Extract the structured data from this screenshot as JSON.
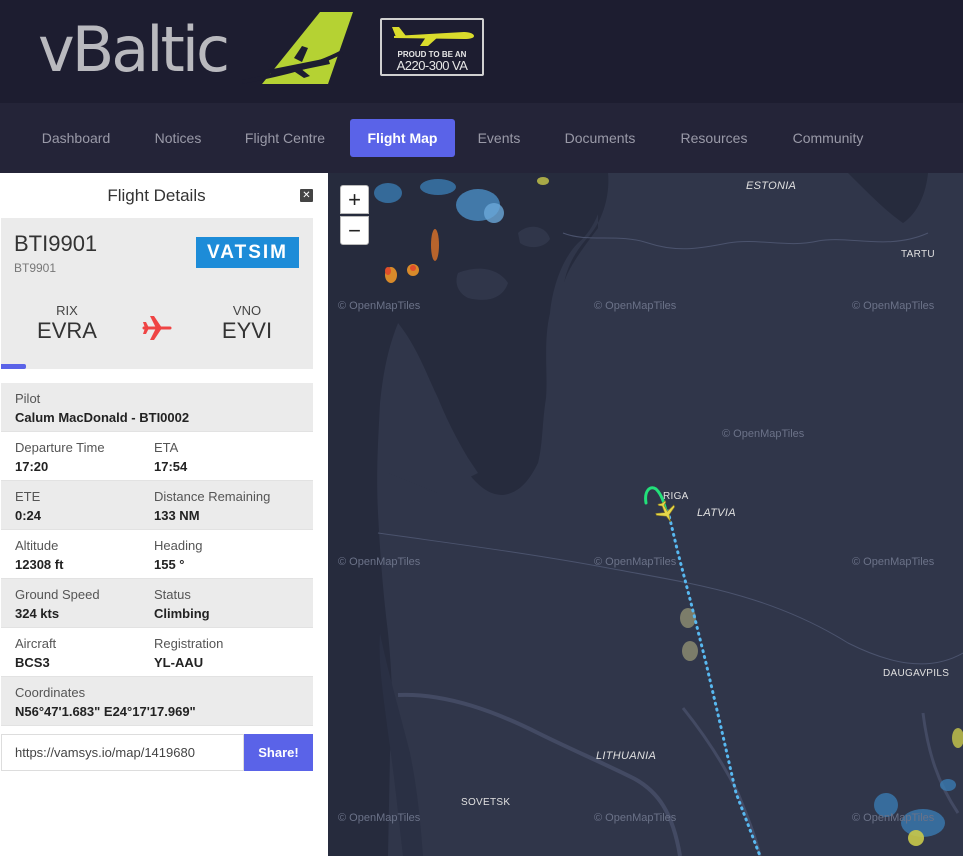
{
  "header": {
    "logo_text": "vBaltic",
    "badge_line1": "PROUD TO BE AN",
    "badge_line2": "A220-300 VA"
  },
  "nav": {
    "items": [
      {
        "label": "Dashboard"
      },
      {
        "label": "Notices"
      },
      {
        "label": "Flight Centre"
      },
      {
        "label": "Flight Map",
        "active": true
      },
      {
        "label": "Events"
      },
      {
        "label": "Documents"
      },
      {
        "label": "Resources"
      },
      {
        "label": "Community"
      }
    ]
  },
  "panel": {
    "title": "Flight Details",
    "close_label": "✕"
  },
  "flight": {
    "callsign": "BTI9901",
    "flight_number": "BT9901",
    "network": "VATSIM",
    "origin": {
      "iata": "RIX",
      "icao": "EVRA"
    },
    "destination": {
      "iata": "VNO",
      "icao": "EYVI"
    },
    "progress_fraction": 0.08
  },
  "details": {
    "pilot_label": "Pilot",
    "pilot_value": "Calum MacDonald - BTI0002",
    "departure_label": "Departure Time",
    "departure_value": "17:20",
    "eta_label": "ETA",
    "eta_value": "17:54",
    "ete_label": "ETE",
    "ete_value": "0:24",
    "distance_label": "Distance Remaining",
    "distance_value": "133 NM",
    "altitude_label": "Altitude",
    "altitude_value": "12308 ft",
    "heading_label": "Heading",
    "heading_value": "155 °",
    "gs_label": "Ground Speed",
    "gs_value": "324 kts",
    "status_label": "Status",
    "status_value": "Climbing",
    "aircraft_label": "Aircraft",
    "aircraft_value": "BCS3",
    "registration_label": "Registration",
    "registration_value": "YL-AAU",
    "coords_label": "Coordinates",
    "coords_value": "N56°47'1.683\" E24°17'17.969\""
  },
  "share": {
    "url": "https://vamsys.io/map/1419680",
    "button_label": "Share!"
  },
  "map": {
    "zoom_in": "+",
    "zoom_out": "−",
    "attribution": "© OpenMapTiles",
    "labels": {
      "estonia": "ESTONIA",
      "tartu": "TARTU",
      "riga": "RIGA",
      "latvia": "LATVIA",
      "daugavpils": "DAUGAVPILS",
      "lithuania": "LITHUANIA",
      "sovetsk": "SOVETSK"
    }
  },
  "colors": {
    "accent": "#5a63e8",
    "header_bg": "#1d1d30",
    "nav_bg": "#242438",
    "vatsim_blue": "#1d8cd8",
    "plane_red": "#ef4444",
    "aircraft_yellow": "#e6d74a",
    "track_green": "#22e07a",
    "route_blue": "#58b8f0",
    "land": "#2f354a",
    "water": "#262b3d"
  }
}
